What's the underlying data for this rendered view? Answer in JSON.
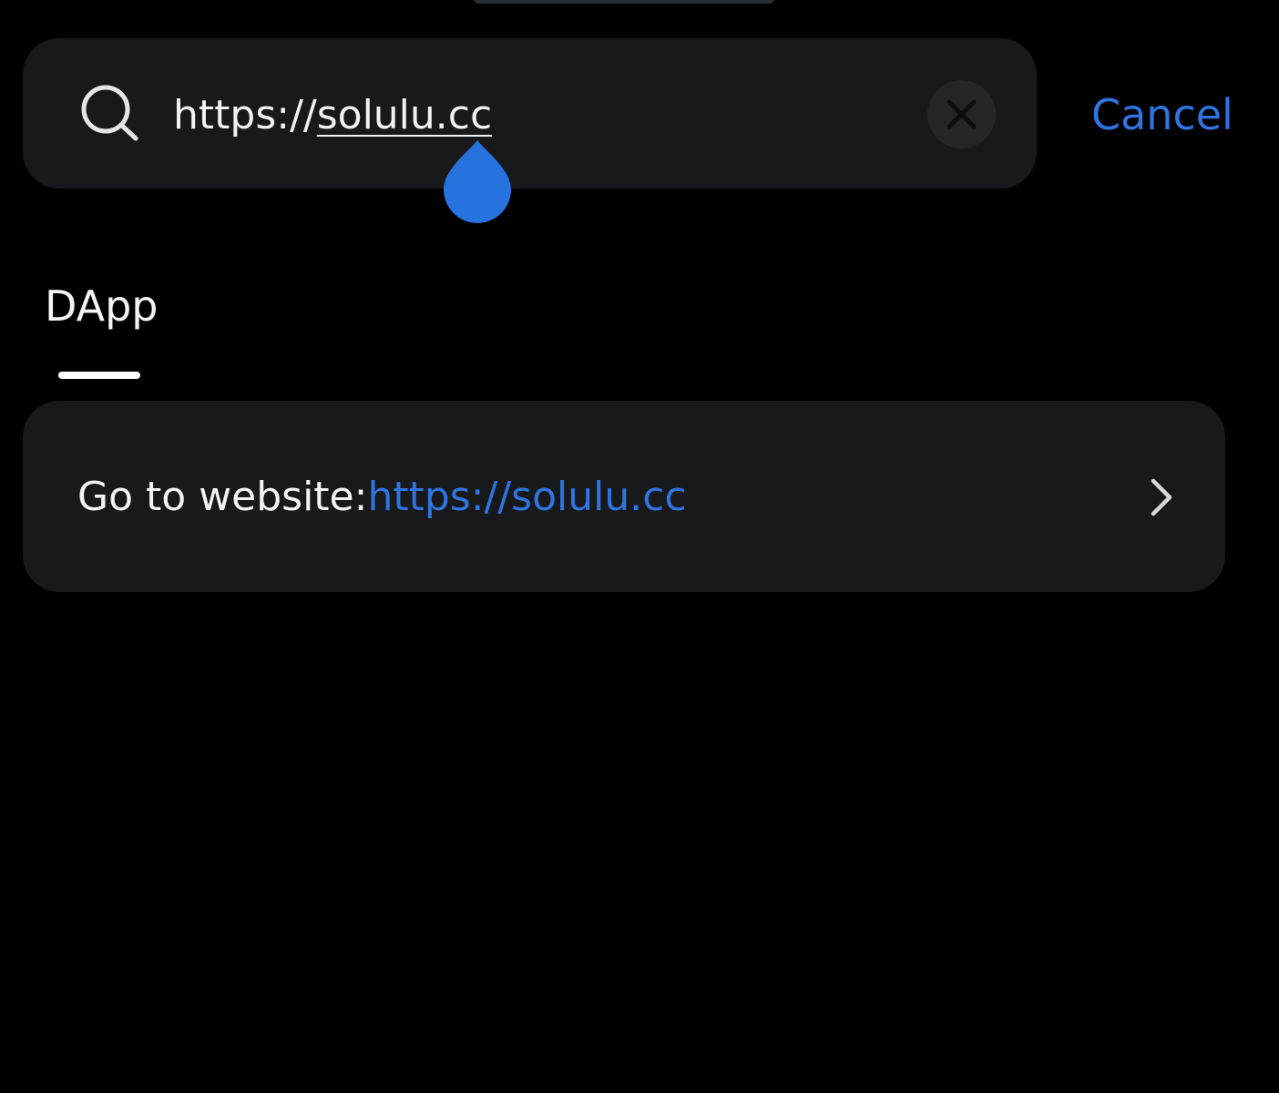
{
  "search": {
    "query_prefix": "https://",
    "query_selected": "solulu.cc",
    "icons": {
      "leading": "search-icon",
      "clear": "close-icon"
    }
  },
  "header": {
    "cancel_label": "Cancel"
  },
  "tabs": [
    {
      "label": "DApp",
      "active": true
    }
  ],
  "results": [
    {
      "prefix": "Go to website:",
      "url": "https://solulu.cc",
      "icon": "chevron-right-icon"
    }
  ],
  "colors": {
    "background": "#000000",
    "surface": "#17191a",
    "accent": "#2f74e0",
    "text": "#f4f4f4"
  }
}
